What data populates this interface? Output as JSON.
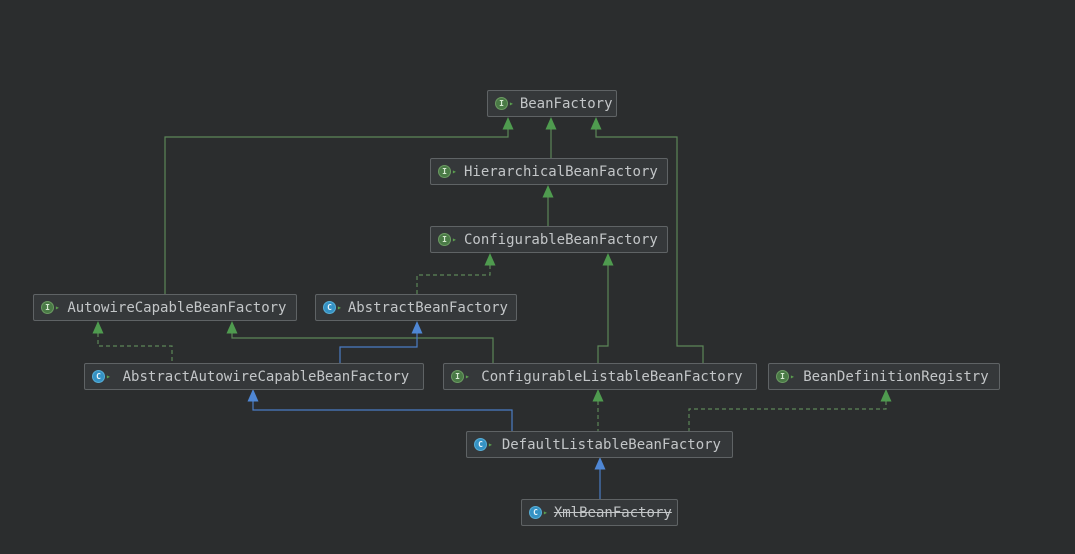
{
  "app": {
    "view": "UML class diagram — Spring BeanFactory hierarchy"
  },
  "colors": {
    "bg": "#2b2d2e",
    "node-fill": "#35383a",
    "node-border": "#5f6365",
    "node-text": "#c3c6c8",
    "edge-green": "#5c8758",
    "edge-blue": "#4a7dc4",
    "arrow-green": "#4f9b4f",
    "arrow-blue": "#4f87d4",
    "icon-interface": "#4a7a46",
    "icon-class": "#3592c4",
    "icon-mod": "#5ba04f"
  },
  "diagram": {
    "nodes": [
      {
        "label": "BeanFactory",
        "kind": "interface",
        "deprecated": false
      },
      {
        "label": "HierarchicalBeanFactory",
        "kind": "interface",
        "deprecated": false
      },
      {
        "label": "ConfigurableBeanFactory",
        "kind": "interface",
        "deprecated": false
      },
      {
        "label": "AutowireCapableBeanFactory",
        "kind": "interface",
        "deprecated": false
      },
      {
        "label": "AbstractBeanFactory",
        "kind": "class",
        "deprecated": false
      },
      {
        "label": "AbstractAutowireCapableBeanFactory",
        "kind": "class",
        "deprecated": false
      },
      {
        "label": "ConfigurableListableBeanFactory",
        "kind": "interface",
        "deprecated": false
      },
      {
        "label": "BeanDefinitionRegistry",
        "kind": "interface",
        "deprecated": false
      },
      {
        "label": "DefaultListableBeanFactory",
        "kind": "class",
        "deprecated": false
      },
      {
        "label": "XmlBeanFactory",
        "kind": "class",
        "deprecated": true
      }
    ],
    "edges": [
      {
        "from": "HierarchicalBeanFactory",
        "to": "BeanFactory",
        "relation": "extends",
        "style": "solid-green"
      },
      {
        "from": "AutowireCapableBeanFactory",
        "to": "BeanFactory",
        "relation": "extends",
        "style": "solid-green"
      },
      {
        "from": "ConfigurableListableBeanFactory",
        "to": "BeanFactory",
        "relation": "extends",
        "style": "solid-green"
      },
      {
        "from": "ConfigurableBeanFactory",
        "to": "HierarchicalBeanFactory",
        "relation": "extends",
        "style": "solid-green"
      },
      {
        "from": "AbstractBeanFactory",
        "to": "ConfigurableBeanFactory",
        "relation": "implements",
        "style": "dashed-green"
      },
      {
        "from": "ConfigurableListableBeanFactory",
        "to": "ConfigurableBeanFactory",
        "relation": "extends",
        "style": "solid-green"
      },
      {
        "from": "ConfigurableListableBeanFactory",
        "to": "AutowireCapableBeanFactory",
        "relation": "extends",
        "style": "solid-green"
      },
      {
        "from": "AbstractAutowireCapableBeanFactory",
        "to": "AutowireCapableBeanFactory",
        "relation": "implements",
        "style": "dashed-green"
      },
      {
        "from": "AbstractAutowireCapableBeanFactory",
        "to": "AbstractBeanFactory",
        "relation": "extends",
        "style": "solid-blue"
      },
      {
        "from": "DefaultListableBeanFactory",
        "to": "ConfigurableListableBeanFactory",
        "relation": "implements",
        "style": "dashed-green"
      },
      {
        "from": "DefaultListableBeanFactory",
        "to": "BeanDefinitionRegistry",
        "relation": "implements",
        "style": "dashed-green"
      },
      {
        "from": "DefaultListableBeanFactory",
        "to": "AbstractAutowireCapableBeanFactory",
        "relation": "extends",
        "style": "solid-blue"
      },
      {
        "from": "XmlBeanFactory",
        "to": "DefaultListableBeanFactory",
        "relation": "extends",
        "style": "solid-blue"
      }
    ]
  }
}
